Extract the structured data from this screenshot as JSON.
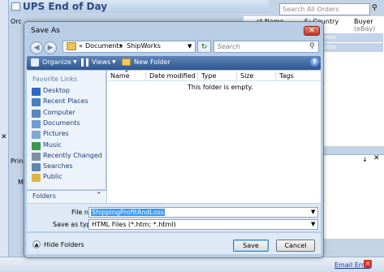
{
  "background_app": {
    "title": "UPS End of Day",
    "col_ord": "Orc",
    "search_placeholder": "Search All Orders",
    "headers": {
      "name": "st Name",
      "country": "S: Country",
      "buyer": "Buyer",
      "buyer_sub": "(eBay)"
    },
    "rows": [
      "tates",
      "tates"
    ],
    "pri": "Prin",
    "mo": "Mo",
    "status_link": "Email Error"
  },
  "dialog": {
    "title": "Save As",
    "address": {
      "chevron": "«",
      "documents": "Documents",
      "separator": "▸",
      "shipworks": "ShipWorks"
    },
    "search_placeholder": "Search",
    "toolbar": {
      "organize": "Organize",
      "views": "Views",
      "new_folder": "New Folder"
    },
    "favorite_links_label": "Favorite Links",
    "nav_items": [
      {
        "label": "Desktop",
        "icon": "desktop-icon",
        "color": "#2f69c4"
      },
      {
        "label": "Recent Places",
        "icon": "recent-places-icon",
        "color": "#4a7fbf"
      },
      {
        "label": "Computer",
        "icon": "computer-icon",
        "color": "#5b86c2"
      },
      {
        "label": "Documents",
        "icon": "documents-icon",
        "color": "#6e9bd6"
      },
      {
        "label": "Pictures",
        "icon": "pictures-icon",
        "color": "#7fa8d8"
      },
      {
        "label": "Music",
        "icon": "music-icon",
        "color": "#3b9a4a"
      },
      {
        "label": "Recently Changed",
        "icon": "recently-changed-icon",
        "color": "#7e8fa6"
      },
      {
        "label": "Searches",
        "icon": "searches-icon",
        "color": "#5f85b5"
      },
      {
        "label": "Public",
        "icon": "public-icon",
        "color": "#e0b64a"
      }
    ],
    "folders_label": "Folders",
    "columns": [
      "Name",
      "Date modified",
      "Type",
      "Size",
      "Tags"
    ],
    "empty_message": "This folder is empty.",
    "file_name_label": "File name:",
    "file_name_value": "ShippingProfitAndLoss",
    "save_as_type_label": "Save as type:",
    "save_as_type_value": "HTML Files (*.htm; *.html)",
    "hide_folders_label": "Hide Folders",
    "save_label": "Save",
    "cancel_label": "Cancel"
  }
}
